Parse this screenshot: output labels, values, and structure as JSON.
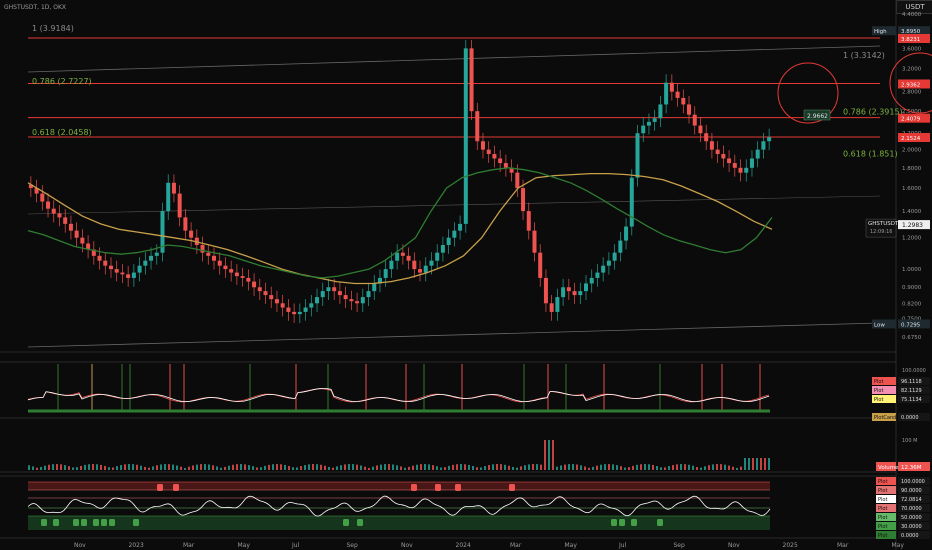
{
  "header": {
    "symbol": "GHSTUSDT",
    "interval": "1D",
    "exchange": "OKX",
    "currency": "USDT"
  },
  "colors": {
    "background": "#0b0b0b",
    "up": "#26a69a",
    "down": "#ef5350",
    "fib_red": "#e53935",
    "ma_fast": "#2e7d32",
    "ma_slow": "#c9a04a",
    "text": "#bdbdbd",
    "fib_green": "#7cb342",
    "fib_gray": "#8a8a8a"
  },
  "price_axis": {
    "scale": "log",
    "ticks": [
      "4.4000",
      "4.0000",
      "3.6000",
      "3.2000",
      "2.8000",
      "2.5000",
      "2.2000",
      "2.0000",
      "1.8000",
      "1.6000",
      "1.4000",
      "1.2000",
      "1.0000",
      "0.9000",
      "0.8200",
      "0.7500",
      "0.6750"
    ],
    "labels": [
      {
        "text": "High",
        "value": "3.8950",
        "price": 4.0,
        "kind": "hl"
      },
      {
        "text": "",
        "value": "3.8231",
        "price": 3.8231,
        "kind": "red"
      },
      {
        "text": "",
        "value": "2.9362",
        "price": 2.9362,
        "kind": "red"
      },
      {
        "text": "",
        "value": "2.4079",
        "price": 2.4079,
        "kind": "red"
      },
      {
        "text": "",
        "value": "2.1524",
        "price": 2.1524,
        "kind": "red"
      },
      {
        "text": "GHSTUSDT",
        "value": "1.2983",
        "price": 1.2983,
        "kind": "current",
        "sub": "12:09:16"
      },
      {
        "text": "Low",
        "value": "0.7295",
        "price": 0.7295,
        "kind": "hl"
      }
    ]
  },
  "fib_labels": [
    {
      "text": "1 (3.9184)",
      "price": 3.98,
      "color": "fib_gray",
      "side": "left"
    },
    {
      "text": "0.786 (2.7227)",
      "price": 2.93,
      "color": "fib_green",
      "side": "left"
    },
    {
      "text": "0.618 (2.0458)",
      "price": 2.18,
      "color": "fib_green",
      "side": "left"
    },
    {
      "text": "1 (3.3142)",
      "price": 3.4,
      "color": "fib_gray",
      "side": "right"
    },
    {
      "text": "0.786 (2.3915)",
      "price": 2.45,
      "color": "fib_green",
      "side": "right"
    },
    {
      "text": "0.618 (1.851)",
      "price": 1.92,
      "color": "fib_green",
      "side": "right"
    }
  ],
  "peak_label": "2.9662",
  "time_axis": [
    "Nov",
    "2023",
    "Mar",
    "May",
    "Jul",
    "Sep",
    "Nov",
    "2024",
    "Mar",
    "May",
    "Jul",
    "Sep",
    "Nov",
    "2025",
    "Mar",
    "May"
  ],
  "indicator1": {
    "labels": [
      {
        "text": "Plot",
        "value": "96.1118",
        "color": "#ef5350"
      },
      {
        "text": "Plot",
        "value": "82.1129",
        "color": "#f48fb1"
      },
      {
        "text": "Plot",
        "value": "75.1134",
        "color": "#fff176"
      },
      {
        "text": "PlotCandle",
        "value": "0.0000",
        "color": "#c9a04a"
      }
    ],
    "tick": "100.0000"
  },
  "volume": {
    "label": "Volume",
    "value": "12.36M",
    "tick": "100 M"
  },
  "indicator2": {
    "labels": [
      {
        "text": "Plot",
        "value": "100.0000",
        "color": "#ef5350"
      },
      {
        "text": "Plot",
        "value": "90.0000",
        "color": "#e57373"
      },
      {
        "text": "Plot",
        "value": "72.0814",
        "color": "#ffffff"
      },
      {
        "text": "Plot",
        "value": "70.0000",
        "color": "#e57373"
      },
      {
        "text": "Plot",
        "value": "50.0000",
        "color": "#66bb6a"
      },
      {
        "text": "Plot",
        "value": "30.0000",
        "color": "#43a047"
      },
      {
        "text": "Plot",
        "value": "0.0000",
        "color": "#2e7d32"
      }
    ]
  },
  "chart_data": {
    "type": "candlestick",
    "y_scale": "log",
    "ylim": [
      0.64,
      4.55
    ],
    "series": [
      {
        "name": "GHSTUSDT",
        "kind": "close_price",
        "values": [
          1.6,
          1.55,
          1.48,
          1.42,
          1.38,
          1.35,
          1.3,
          1.25,
          1.2,
          1.16,
          1.12,
          1.08,
          1.05,
          1.02,
          1.0,
          0.98,
          0.97,
          0.95,
          0.98,
          1.02,
          1.05,
          1.08,
          1.1,
          1.4,
          1.65,
          1.55,
          1.35,
          1.25,
          1.2,
          1.15,
          1.1,
          1.08,
          1.05,
          1.02,
          1.0,
          0.98,
          0.96,
          0.95,
          0.93,
          0.9,
          0.88,
          0.86,
          0.84,
          0.82,
          0.8,
          0.78,
          0.77,
          0.78,
          0.8,
          0.82,
          0.85,
          0.88,
          0.9,
          0.88,
          0.86,
          0.84,
          0.83,
          0.82,
          0.85,
          0.88,
          0.92,
          0.95,
          1.0,
          1.05,
          1.1,
          1.08,
          1.05,
          1.0,
          0.98,
          1.02,
          1.05,
          1.1,
          1.15,
          1.2,
          1.25,
          1.3,
          3.6,
          2.5,
          2.1,
          2.0,
          1.95,
          1.9,
          1.85,
          1.8,
          1.75,
          1.6,
          1.4,
          1.25,
          1.1,
          0.95,
          0.82,
          0.78,
          0.85,
          0.9,
          0.88,
          0.86,
          0.88,
          0.92,
          0.95,
          0.98,
          1.02,
          1.05,
          1.1,
          1.18,
          1.28,
          1.7,
          2.2,
          2.3,
          2.35,
          2.4,
          2.6,
          2.95,
          2.8,
          2.7,
          2.6,
          2.45,
          2.3,
          2.2,
          2.1,
          2.0,
          1.95,
          1.9,
          1.85,
          1.8,
          1.75,
          1.8,
          1.9,
          2.0,
          2.1,
          2.15
        ]
      },
      {
        "name": "",
        "kind": "moving_average_fast",
        "values": [
          1.25,
          1.22,
          1.18,
          1.14,
          1.12,
          1.1,
          1.09,
          1.1,
          1.12,
          1.15,
          1.14,
          1.12,
          1.1,
          1.08,
          1.05,
          1.02,
          1.0,
          0.98,
          0.96,
          0.95,
          0.96,
          0.98,
          1.0,
          1.05,
          1.12,
          1.2,
          1.4,
          1.6,
          1.7,
          1.75,
          1.78,
          1.8,
          1.78,
          1.75,
          1.7,
          1.65,
          1.58,
          1.5,
          1.42,
          1.35,
          1.28,
          1.22,
          1.18,
          1.15,
          1.12,
          1.1,
          1.12,
          1.2,
          1.35
        ]
      },
      {
        "name": "",
        "kind": "moving_average_slow",
        "values": [
          1.65,
          1.55,
          1.45,
          1.36,
          1.3,
          1.26,
          1.24,
          1.22,
          1.2,
          1.18,
          1.15,
          1.12,
          1.08,
          1.04,
          1.0,
          0.97,
          0.95,
          0.93,
          0.92,
          0.92,
          0.93,
          0.95,
          0.98,
          1.02,
          1.08,
          1.2,
          1.4,
          1.6,
          1.7,
          1.72,
          1.73,
          1.74,
          1.74,
          1.73,
          1.71,
          1.68,
          1.62,
          1.55,
          1.48,
          1.4,
          1.32,
          1.26
        ]
      }
    ]
  }
}
